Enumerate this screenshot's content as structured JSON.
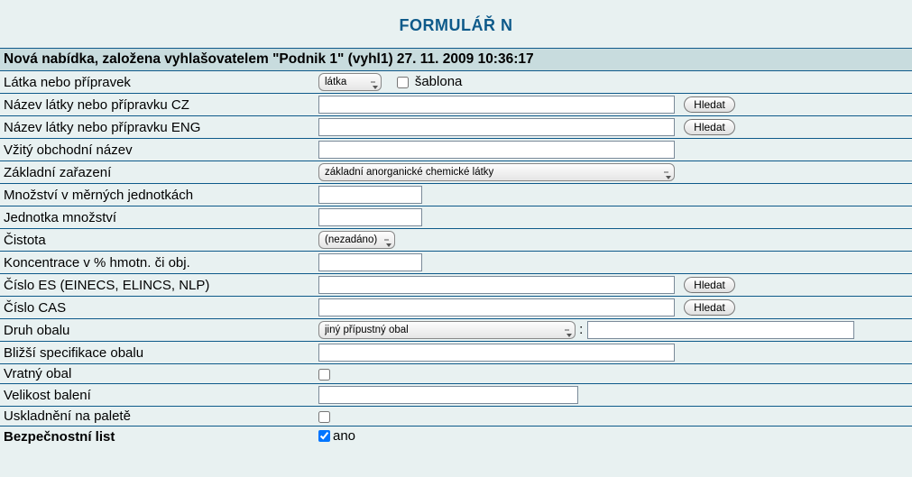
{
  "title": "FORMULÁŘ N",
  "header": "Nová nabídka, založena vyhlašovatelem \"Podnik 1\" (vyhl1) 27. 11. 2009 10:36:17",
  "rows": {
    "substance_label": "Látka nebo přípravek",
    "substance_select": "látka",
    "template_cb_label": "šablona",
    "name_cz_label": "Název látky nebo přípravku CZ",
    "name_eng_label": "Název látky nebo přípravku ENG",
    "trade_name_label": "Vžitý obchodní název",
    "classification_label": "Základní zařazení",
    "classification_select": "základní anorganické chemické látky",
    "qty_label": "Množství v měrných jednotkách",
    "unit_label": "Jednotka množství",
    "purity_label": "Čistota",
    "purity_select": "(nezadáno)",
    "concentration_label": "Koncentrace v % hmotn. či obj.",
    "es_label": "Číslo ES (EINECS, ELINCS, NLP)",
    "cas_label": "Číslo CAS",
    "packaging_type_label": "Druh obalu",
    "packaging_type_select": "jiný přípustný obal",
    "packaging_spec_label": "Bližší specifikace obalu",
    "returnable_label": "Vratný obal",
    "pack_size_label": "Velikost balení",
    "pallet_label": "Uskladnění na paletě",
    "safety_sheet_label": "Bezpečnostní list",
    "yes_label": "ano"
  },
  "buttons": {
    "search": "Hledat"
  },
  "values": {
    "substance": "látka",
    "template_checked": false,
    "name_cz": "",
    "name_eng": "",
    "trade_name": "",
    "classification": "základní anorganické chemické látky",
    "qty": "",
    "unit": "",
    "purity": "(nezadáno)",
    "concentration": "",
    "es": "",
    "cas": "",
    "packaging_type": "jiný přípustný obal",
    "packaging_type_other": "",
    "packaging_spec": "",
    "returnable": false,
    "pack_size": "",
    "pallet": false,
    "safety_sheet": true
  }
}
